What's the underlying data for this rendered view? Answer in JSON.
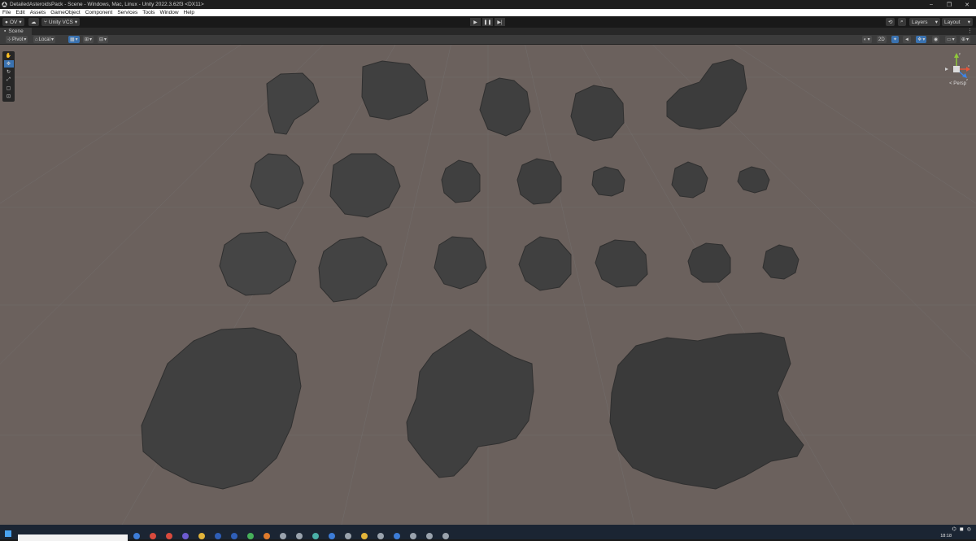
{
  "window": {
    "title": "DetailedAsteroidsPack - Scene - Windows, Mac, Linux - Unity 2022.3.62f3 <DX11>",
    "minimize": "–",
    "maximize": "❐",
    "close": "✕"
  },
  "menu": [
    "File",
    "Edit",
    "Assets",
    "GameObject",
    "Component",
    "Services",
    "Tools",
    "Window",
    "Help"
  ],
  "toolbar": {
    "account": "OV",
    "vcs": "Unity VCS",
    "play": "▶",
    "pause": "❚❚",
    "step": "▶|",
    "layers": "Layers",
    "layout": "Layout"
  },
  "scene_tab": {
    "label": "Scene",
    "more": "⋮"
  },
  "scene_options": {
    "pivot": "Pivot",
    "local": "Local",
    "mode_2d": "2D"
  },
  "gizmo": {
    "projection": "< Persp",
    "axis_y": "y",
    "axis_x": "x",
    "axis_z": "z"
  },
  "tools": [
    "view-tool",
    "move-tool",
    "rotate-tool",
    "scale-tool",
    "rect-tool",
    "transform-tool"
  ],
  "taskbar": {
    "time": "18:18"
  },
  "colors": {
    "viewport_bg": "#6b615d",
    "grid_line": "#7a7e80",
    "asteroid": "#3f3f3f",
    "active_blue": "#3a72b0"
  }
}
